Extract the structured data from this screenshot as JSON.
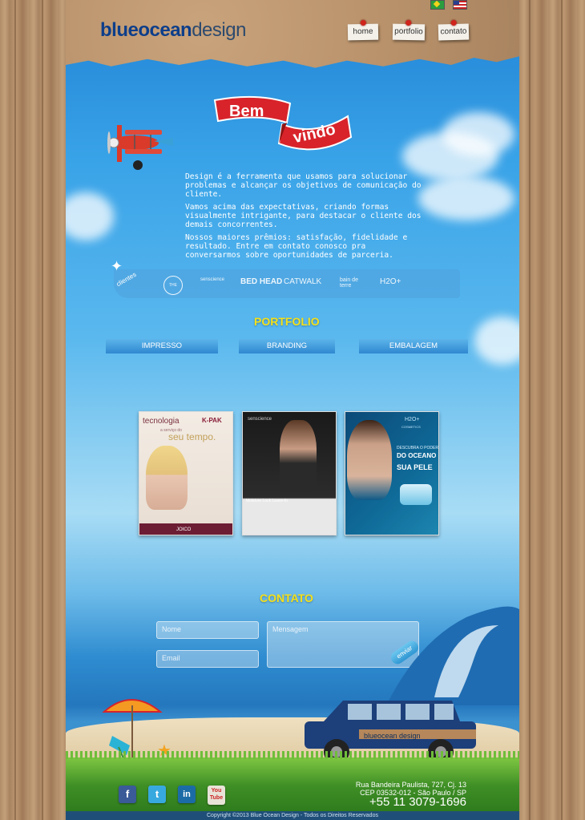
{
  "header": {
    "logo_bold": "blueocean",
    "logo_light": "design",
    "nav": [
      {
        "label": "home"
      },
      {
        "label": "portfolio"
      },
      {
        "label": "contato"
      }
    ]
  },
  "welcome": {
    "line1": "Bem",
    "line2": "vindo"
  },
  "intro": {
    "p1": "Design é a ferramenta que usamos para solucionar problemas e alcançar os objetivos de comunicação do cliente.",
    "p2": "Vamos acima das expectativas, criando formas visualmente intrigante, para destacar o cliente dos demais concorrentes.",
    "p3": "Nossos maiores prêmios: satisfação, fidelidade e resultado. Entre em contato conosco pra conversarmos sobre oportunidades de parceria."
  },
  "clients": {
    "label": "clientes",
    "logos": [
      "THE BODY SHOP",
      "senscience",
      "BED HEAD",
      "CATWALK",
      "bain de terre",
      "H2O+"
    ]
  },
  "portfolio": {
    "title": "PORTFOLIO",
    "tabs": [
      "IMPRESSO",
      "BRANDING",
      "EMBALAGEM"
    ],
    "thumbs": [
      {
        "line1": "tecnologia",
        "line2": "a serviço do",
        "line3": "seu tempo.",
        "brand": "K-PAK",
        "footer": "JOICO"
      },
      {
        "brand": "senscience",
        "product": "Moisture Lock Leave-In"
      },
      {
        "brand": "H2O+",
        "sub": "COSMETICS",
        "line1": "DESCUBRA O PODER",
        "line2": "DO OCEANO",
        "line3": "SUA PELE"
      }
    ]
  },
  "contact": {
    "title": "CONTATO",
    "name_placeholder": "Nome",
    "email_placeholder": "Email",
    "message_placeholder": "Mensagem",
    "send_label": "enviar"
  },
  "car_label": "blueocean design",
  "footer": {
    "address_line1": "Rua Bandeira Paulista, 727, Cj. 13",
    "address_line2": "CEP 03532-012 - São Paulo / SP",
    "phone": "+55 11 3079-1696",
    "copyright": "Copyright ©2013 Blue Ocean Design - Todos os Direitos Reservados",
    "youtube_label": "You Tube"
  },
  "colors": {
    "accent_yellow": "#f4e01a",
    "ribbon_red": "#d8232a",
    "logo_blue": "#0d3e8a"
  }
}
